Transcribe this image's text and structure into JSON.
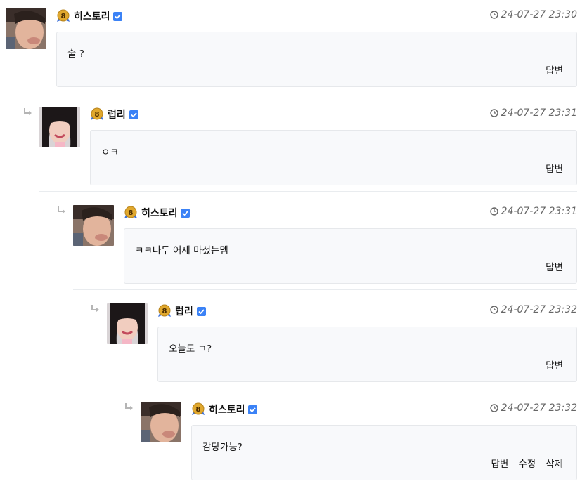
{
  "comments": [
    {
      "nickname": "히스토리",
      "avatar_icon": "user-photo-male",
      "level": "8",
      "date": "24-07-27 23:30",
      "text": "술 ?",
      "actions": [
        "답변"
      ]
    },
    {
      "nickname": "럽리",
      "avatar_icon": "user-photo-female",
      "level": "8",
      "date": "24-07-27 23:31",
      "text": "ㅇㅋ",
      "actions": [
        "답변"
      ]
    },
    {
      "nickname": "히스토리",
      "avatar_icon": "user-photo-male",
      "level": "8",
      "date": "24-07-27 23:31",
      "text": "ㅋㅋ나두 어제 마셨는뎀",
      "actions": [
        "답변"
      ]
    },
    {
      "nickname": "럽리",
      "avatar_icon": "user-photo-female",
      "level": "8",
      "date": "24-07-27 23:32",
      "text": "오늘도 ㄱ?",
      "actions": [
        "답변"
      ]
    },
    {
      "nickname": "히스토리",
      "avatar_icon": "user-photo-male",
      "level": "8",
      "date": "24-07-27 23:32",
      "text": "감당가능?",
      "actions": [
        "답변",
        "수정",
        "삭제"
      ]
    }
  ],
  "colors": {
    "verified": "#3b82f6",
    "badge_gold": "#e0a82e",
    "reply_arrow": "#b5b5b5",
    "bubble_bg": "#f8f9fb"
  }
}
